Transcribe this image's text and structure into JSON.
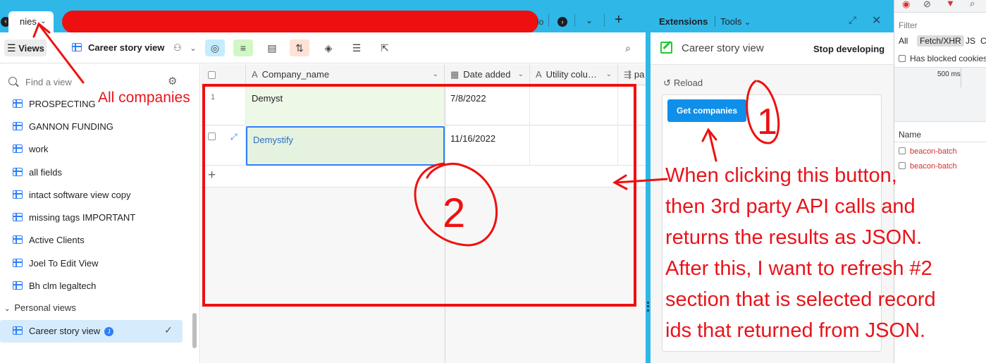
{
  "base_tab": {
    "label_fragment": "nies",
    "overflow_fragment": "io"
  },
  "toolbar": {
    "views_label": "Views",
    "view_name": "Career story view"
  },
  "sidebar": {
    "find_placeholder": "Find a view",
    "views": [
      "PROSPECTING",
      "GANNON FUNDING",
      "work",
      "all fields",
      "intact software view copy",
      "missing tags IMPORTANT",
      "Active Clients",
      "Joel To Edit View",
      "Bh clm legaltech"
    ],
    "personal_section": "Personal views",
    "personal_views": [
      {
        "label": "Career story view",
        "badge": "J",
        "selected": true
      }
    ]
  },
  "grid": {
    "columns": [
      "Company_name",
      "Date added",
      "Utility colu…",
      "pa"
    ],
    "rows": [
      {
        "number": "1",
        "company": "Demyst",
        "date": "7/8/2022"
      },
      {
        "number": "",
        "company": "Demystify",
        "date": "11/16/2022"
      }
    ]
  },
  "extensions": {
    "tab_label": "Extensions",
    "tools_label": "Tools",
    "app_title": "Career story view",
    "stop_label": "Stop developing",
    "reload_label": "Reload",
    "button_label": "Get companies"
  },
  "devtools": {
    "filter_label": "Filter",
    "type_tabs": [
      "All",
      "Fetch/XHR",
      "JS",
      "C"
    ],
    "blocked_label": "Has blocked cookies",
    "timeline_label": "500 ms",
    "name_header": "Name",
    "requests": [
      "beacon-batch",
      "beacon-batch"
    ]
  },
  "annotations": {
    "left_note": "All companies",
    "marker_one": "1",
    "marker_two": "2",
    "note_lines": [
      "When clicking this button,",
      "then 3rd party API calls and",
      "returns the results as JSON.",
      "After this, I want to refresh #2",
      "section that is selected record",
      "ids that returned from JSON."
    ],
    "color": "#e8141b"
  }
}
